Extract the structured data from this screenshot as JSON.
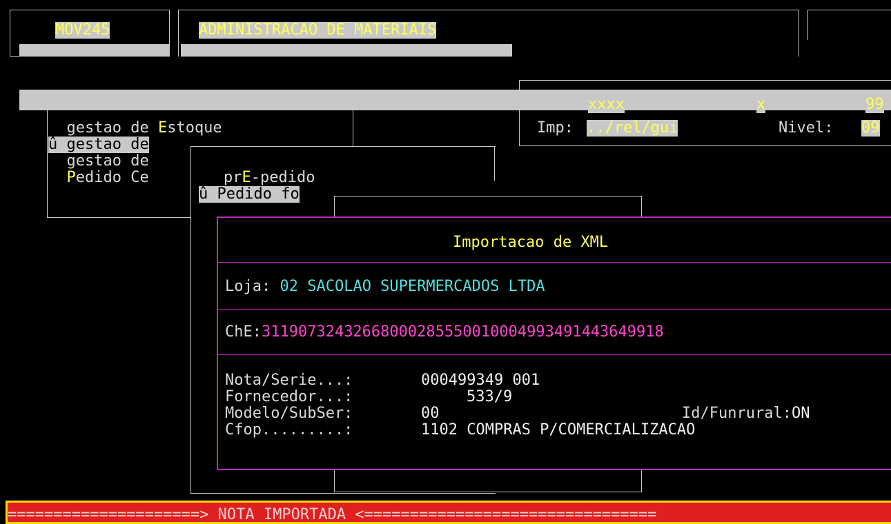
{
  "header": {
    "program_code": "MOV245",
    "system_title": "ADMINISTRACAO DE MATERIAIS"
  },
  "info": {
    "user": "xxxx",
    "x_label": "x",
    "x_value": "99",
    "imp_label": "Imp:",
    "imp_value": "../rel/gui",
    "nivel_label": "Nivel:",
    "nivel_value": "09"
  },
  "menu1": {
    "items": [
      {
        "prefix": "  gestao de ",
        "hotkey": "E",
        "rest": "stoque"
      },
      {
        "prefix": "û ",
        "label": "gestao de"
      },
      {
        "label": "  gestao de"
      },
      {
        "prefix": "  ",
        "hotkey": "P",
        "rest": "edido Ce"
      }
    ]
  },
  "menu2": {
    "items": [
      {
        "before": "prE-pedido"
      },
      {
        "prefix": "û ",
        "label": "Pedido fo"
      }
    ]
  },
  "menu2_hotkey": "E",
  "dialog": {
    "title": "Importacao de XML",
    "loja_label": "Loja:",
    "loja_value": "02 SACOLAO SUPERMERCADOS LTDA",
    "che_label": "ChE:",
    "che_value": "31190732432668000285550010004993491443649918",
    "fields": {
      "nota_label": "Nota/Serie...:",
      "nota_value": "000499349 001",
      "fornecedor_label": "Fornecedor...:",
      "fornecedor_value": "533/9",
      "modelo_label": "Modelo/SubSer:",
      "modelo_value": "00",
      "funrural_label": "Id/Funrural:",
      "funrural_value": "ON",
      "cfop_label": "Cfop.........:",
      "cfop_value": "1102 COMPRAS P/COMERCIALIZACAO"
    }
  },
  "status": {
    "message": "=====================> NOTA IMPORTADA <================================"
  },
  "colors": {
    "background": "#000000",
    "highlight_yellow": "#ffff55",
    "cyan": "#55dddd",
    "magenta": "#ff44cc",
    "status_red": "#e02020",
    "status_border": "#ffd700"
  }
}
